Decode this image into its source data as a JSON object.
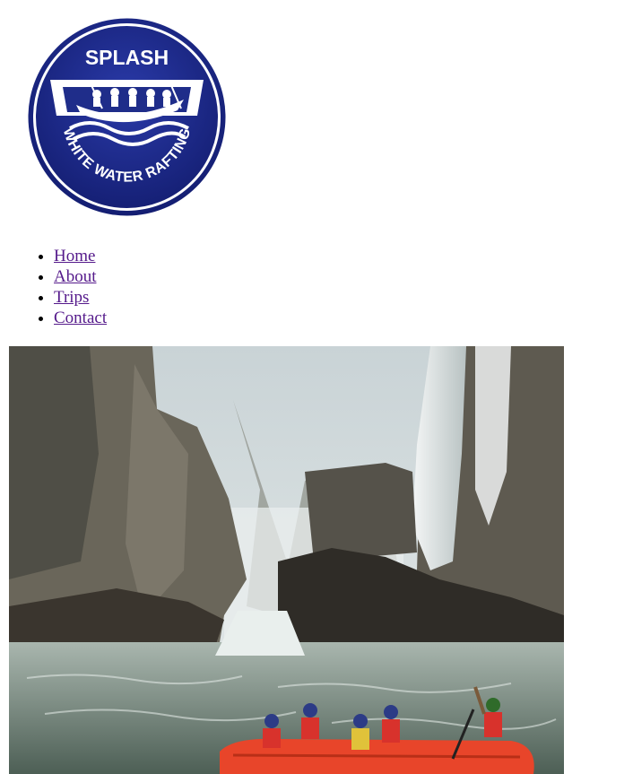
{
  "logo": {
    "top_text": "SPLASH",
    "arc_text": "WHITE WATER RAFTING",
    "colors": {
      "primary": "#1f2d8a",
      "dark": "#14206b",
      "bg": "#ffffff"
    }
  },
  "nav": {
    "items": [
      {
        "label": "Home",
        "state": "visited"
      },
      {
        "label": "About",
        "state": "link"
      },
      {
        "label": "Trips",
        "state": "link"
      },
      {
        "label": "Contact",
        "state": "link"
      }
    ]
  },
  "hero": {
    "subject": "white-water-raft-in-gorge-below-waterfall"
  }
}
